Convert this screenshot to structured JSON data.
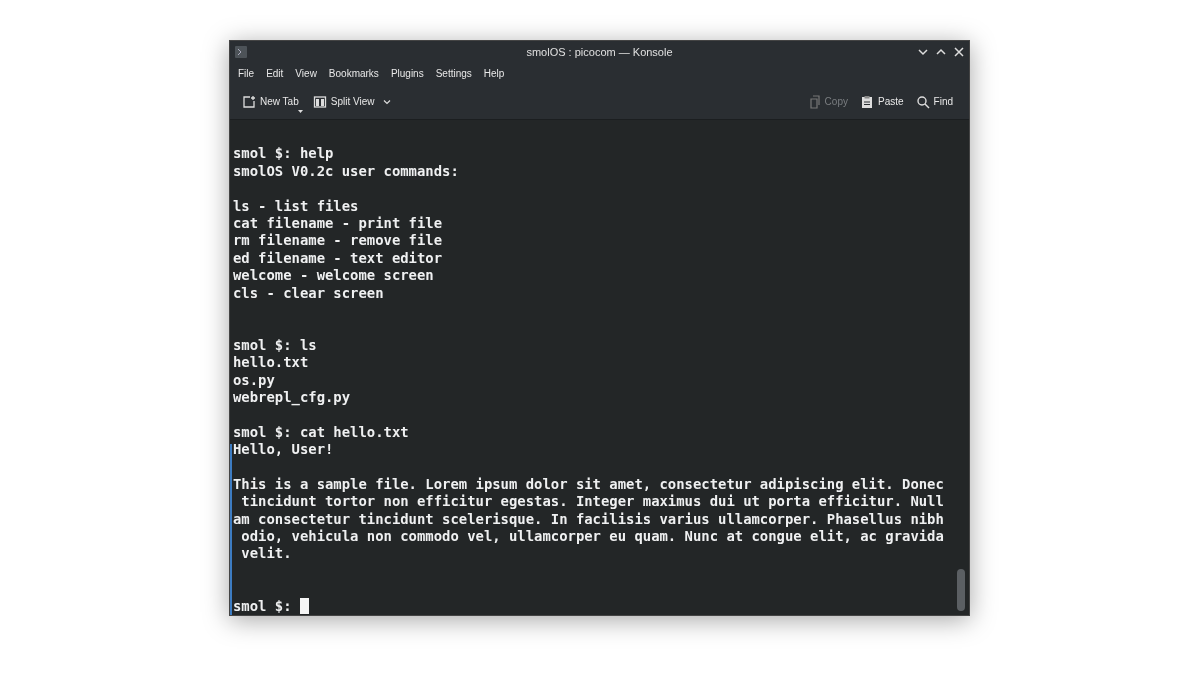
{
  "window": {
    "title": "smolOS : picocom — Konsole"
  },
  "menu": [
    "File",
    "Edit",
    "View",
    "Bookmarks",
    "Plugins",
    "Settings",
    "Help"
  ],
  "toolbar": [
    {
      "kind": "new-tab",
      "label": "New Tab",
      "disabled": false
    },
    {
      "kind": "split-view",
      "label": "Split View",
      "disabled": false
    },
    {
      "kind": "copy",
      "label": "Copy",
      "disabled": true
    },
    {
      "kind": "paste",
      "label": "Paste",
      "disabled": false
    },
    {
      "kind": "find",
      "label": "Find",
      "disabled": false
    }
  ],
  "terminal": {
    "lines": [
      {
        "kind": "blank"
      },
      {
        "kind": "text",
        "text": "smol $: help"
      },
      {
        "kind": "text",
        "text": "smolOS V0.2c user commands:"
      },
      {
        "kind": "blank"
      },
      {
        "kind": "text",
        "text": "ls - list files"
      },
      {
        "kind": "text",
        "text": "cat filename - print file"
      },
      {
        "kind": "text",
        "text": "rm filename - remove file"
      },
      {
        "kind": "text",
        "text": "ed filename - text editor"
      },
      {
        "kind": "text",
        "text": "welcome - welcome screen"
      },
      {
        "kind": "text",
        "text": "cls - clear screen"
      },
      {
        "kind": "blank"
      },
      {
        "kind": "blank"
      },
      {
        "kind": "text",
        "text": "smol $: ls"
      },
      {
        "kind": "text",
        "text": "hello.txt"
      },
      {
        "kind": "text",
        "text": "os.py"
      },
      {
        "kind": "text",
        "text": "webrepl_cfg.py"
      },
      {
        "kind": "blank"
      },
      {
        "kind": "text",
        "text": "smol $: cat hello.txt"
      },
      {
        "kind": "text",
        "text": "Hello, User!"
      },
      {
        "kind": "blank"
      },
      {
        "kind": "text",
        "text": "This is a sample file. Lorem ipsum dolor sit amet, consectetur adipiscing elit. Donec"
      },
      {
        "kind": "text",
        "text": " tincidunt tortor non efficitur egestas. Integer maximus dui ut porta efficitur. Null"
      },
      {
        "kind": "text",
        "text": "am consectetur tincidunt scelerisque. In facilisis varius ullamcorper. Phasellus nibh"
      },
      {
        "kind": "text",
        "text": " odio, vehicula non commodo vel, ullamcorper eu quam. Nunc at congue elit, ac gravida"
      },
      {
        "kind": "text",
        "text": " velit."
      },
      {
        "kind": "blank"
      },
      {
        "kind": "blank"
      },
      {
        "kind": "prompt",
        "text": "smol $: "
      }
    ]
  }
}
